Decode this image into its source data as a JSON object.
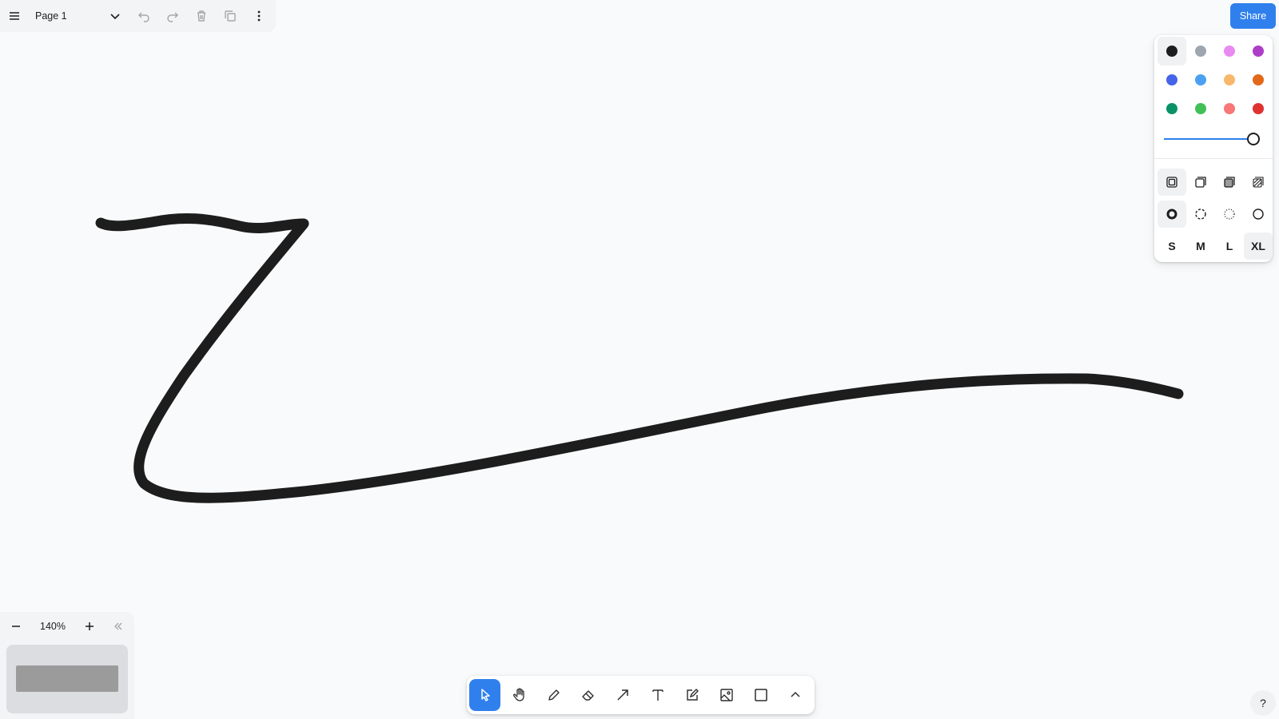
{
  "menu": {
    "page_name": "Page 1"
  },
  "share_label": "Share",
  "style_panel": {
    "colors": [
      "#1d1d1d",
      "#9ea6b0",
      "#e98af3",
      "#ae3ec9",
      "#4465e9",
      "#4ba1f1",
      "#f8b86c",
      "#e16919",
      "#099268",
      "#40c057",
      "#f87777",
      "#e03131"
    ],
    "selected_color": "#1d1d1d",
    "opacity_percent": 100,
    "size_labels": [
      "S",
      "M",
      "L",
      "XL"
    ],
    "selected_size": "XL"
  },
  "zoom": {
    "value": "140%"
  },
  "help_label": "?"
}
